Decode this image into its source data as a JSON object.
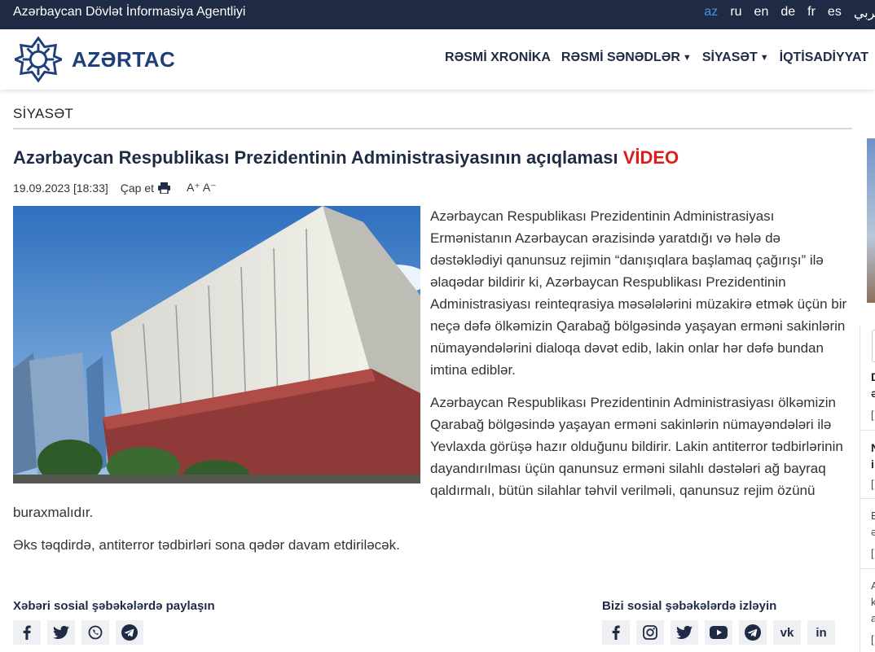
{
  "topbar": {
    "agency": "Azərbaycan Dövlət İnformasiya Agentliyi",
    "languages": [
      {
        "code": "az",
        "active": true
      },
      {
        "code": "ru",
        "active": false
      },
      {
        "code": "en",
        "active": false
      },
      {
        "code": "de",
        "active": false
      },
      {
        "code": "fr",
        "active": false
      },
      {
        "code": "es",
        "active": false
      },
      {
        "code": "عربي",
        "active": false
      }
    ]
  },
  "header": {
    "brand": "AZƏRTAC",
    "nav": [
      {
        "label": "RƏSMİ XRONİKA",
        "dropdown": false
      },
      {
        "label": "RƏSMİ SƏNƏDLƏR",
        "dropdown": true
      },
      {
        "label": "SİYASƏT",
        "dropdown": true
      },
      {
        "label": "İQTİSADİYYAT",
        "dropdown": false
      }
    ]
  },
  "article": {
    "section": "SİYASƏT",
    "title": "Azərbaycan Respublikası Prezidentinin Administrasiyasının açıqlaması",
    "title_tag": "VİDEO",
    "date": "19.09.2023 [18:33]",
    "print_label": "Çap et",
    "font_size_label": "A⁺ A⁻",
    "paragraphs": [
      "Azərbaycan Respublikası Prezidentinin Administrasiyası Ermənistanın Azərbaycan ərazisində yaratdığı və hələ də dəstəklədiyi qanunsuz rejimin “danışıqlara başlamaq çağırışı” ilə əlaqədar bildirir ki, Azərbaycan Respublikası Prezidentinin Administrasiyası reinteqrasiya məsələlərini müzakirə etmək üçün bir neçə dəfə ölkəmizin Qarabağ bölgəsində yaşayan erməni sakinlərin nümayəndələrini dialoqa dəvət edib, lakin onlar hər dəfə bundan imtina ediblər.",
      "Azərbaycan Respublikası Prezidentinin Administrasiyası ölkəmizin Qarabağ bölgəsində yaşayan erməni sakinlərin nümayəndələri ilə Yevlaxda görüşə hazır olduğunu bildirir. Lakin antiterror tədbirlərinin dayandırılması üçün qanunsuz erməni silahlı dəstələri ağ bayraq qaldırmalı, bütün silahlar təhvil verilməli, qanunsuz rejim özünü buraxmalıdır.",
      "Əks təqdirdə, antiterror tədbirləri sona qədər davam etdiriləcək."
    ]
  },
  "social": {
    "share_title": "Xəbəri sosial şəbəkələrdə paylaşın",
    "share_icons": [
      "facebook-icon",
      "twitter-icon",
      "whatsapp-icon",
      "telegram-icon"
    ],
    "follow_title": "Bizi sosial şəbəkələrdə izləyin",
    "follow_icons": [
      "facebook-icon",
      "instagram-icon",
      "twitter-icon",
      "youtube-icon",
      "telegram-icon",
      "vk-icon",
      "linkedin-icon"
    ],
    "vk_text": "vk",
    "linkedin_text": "in"
  },
  "sidebar": {
    "items": [
      {
        "line1": "D",
        "line2": "ə",
        "date": "["
      },
      {
        "line1": "N",
        "line2": "i",
        "date": "["
      },
      {
        "line1": "E",
        "line2": "ə",
        "date": "["
      },
      {
        "line1": "A",
        "line2": "k",
        "line3": "a",
        "date": "["
      }
    ]
  },
  "colors": {
    "topbar_bg": "#1f2b45",
    "active_lang": "#4a90e2",
    "brand": "#1f3f7a",
    "video_tag": "#e01b1b"
  }
}
